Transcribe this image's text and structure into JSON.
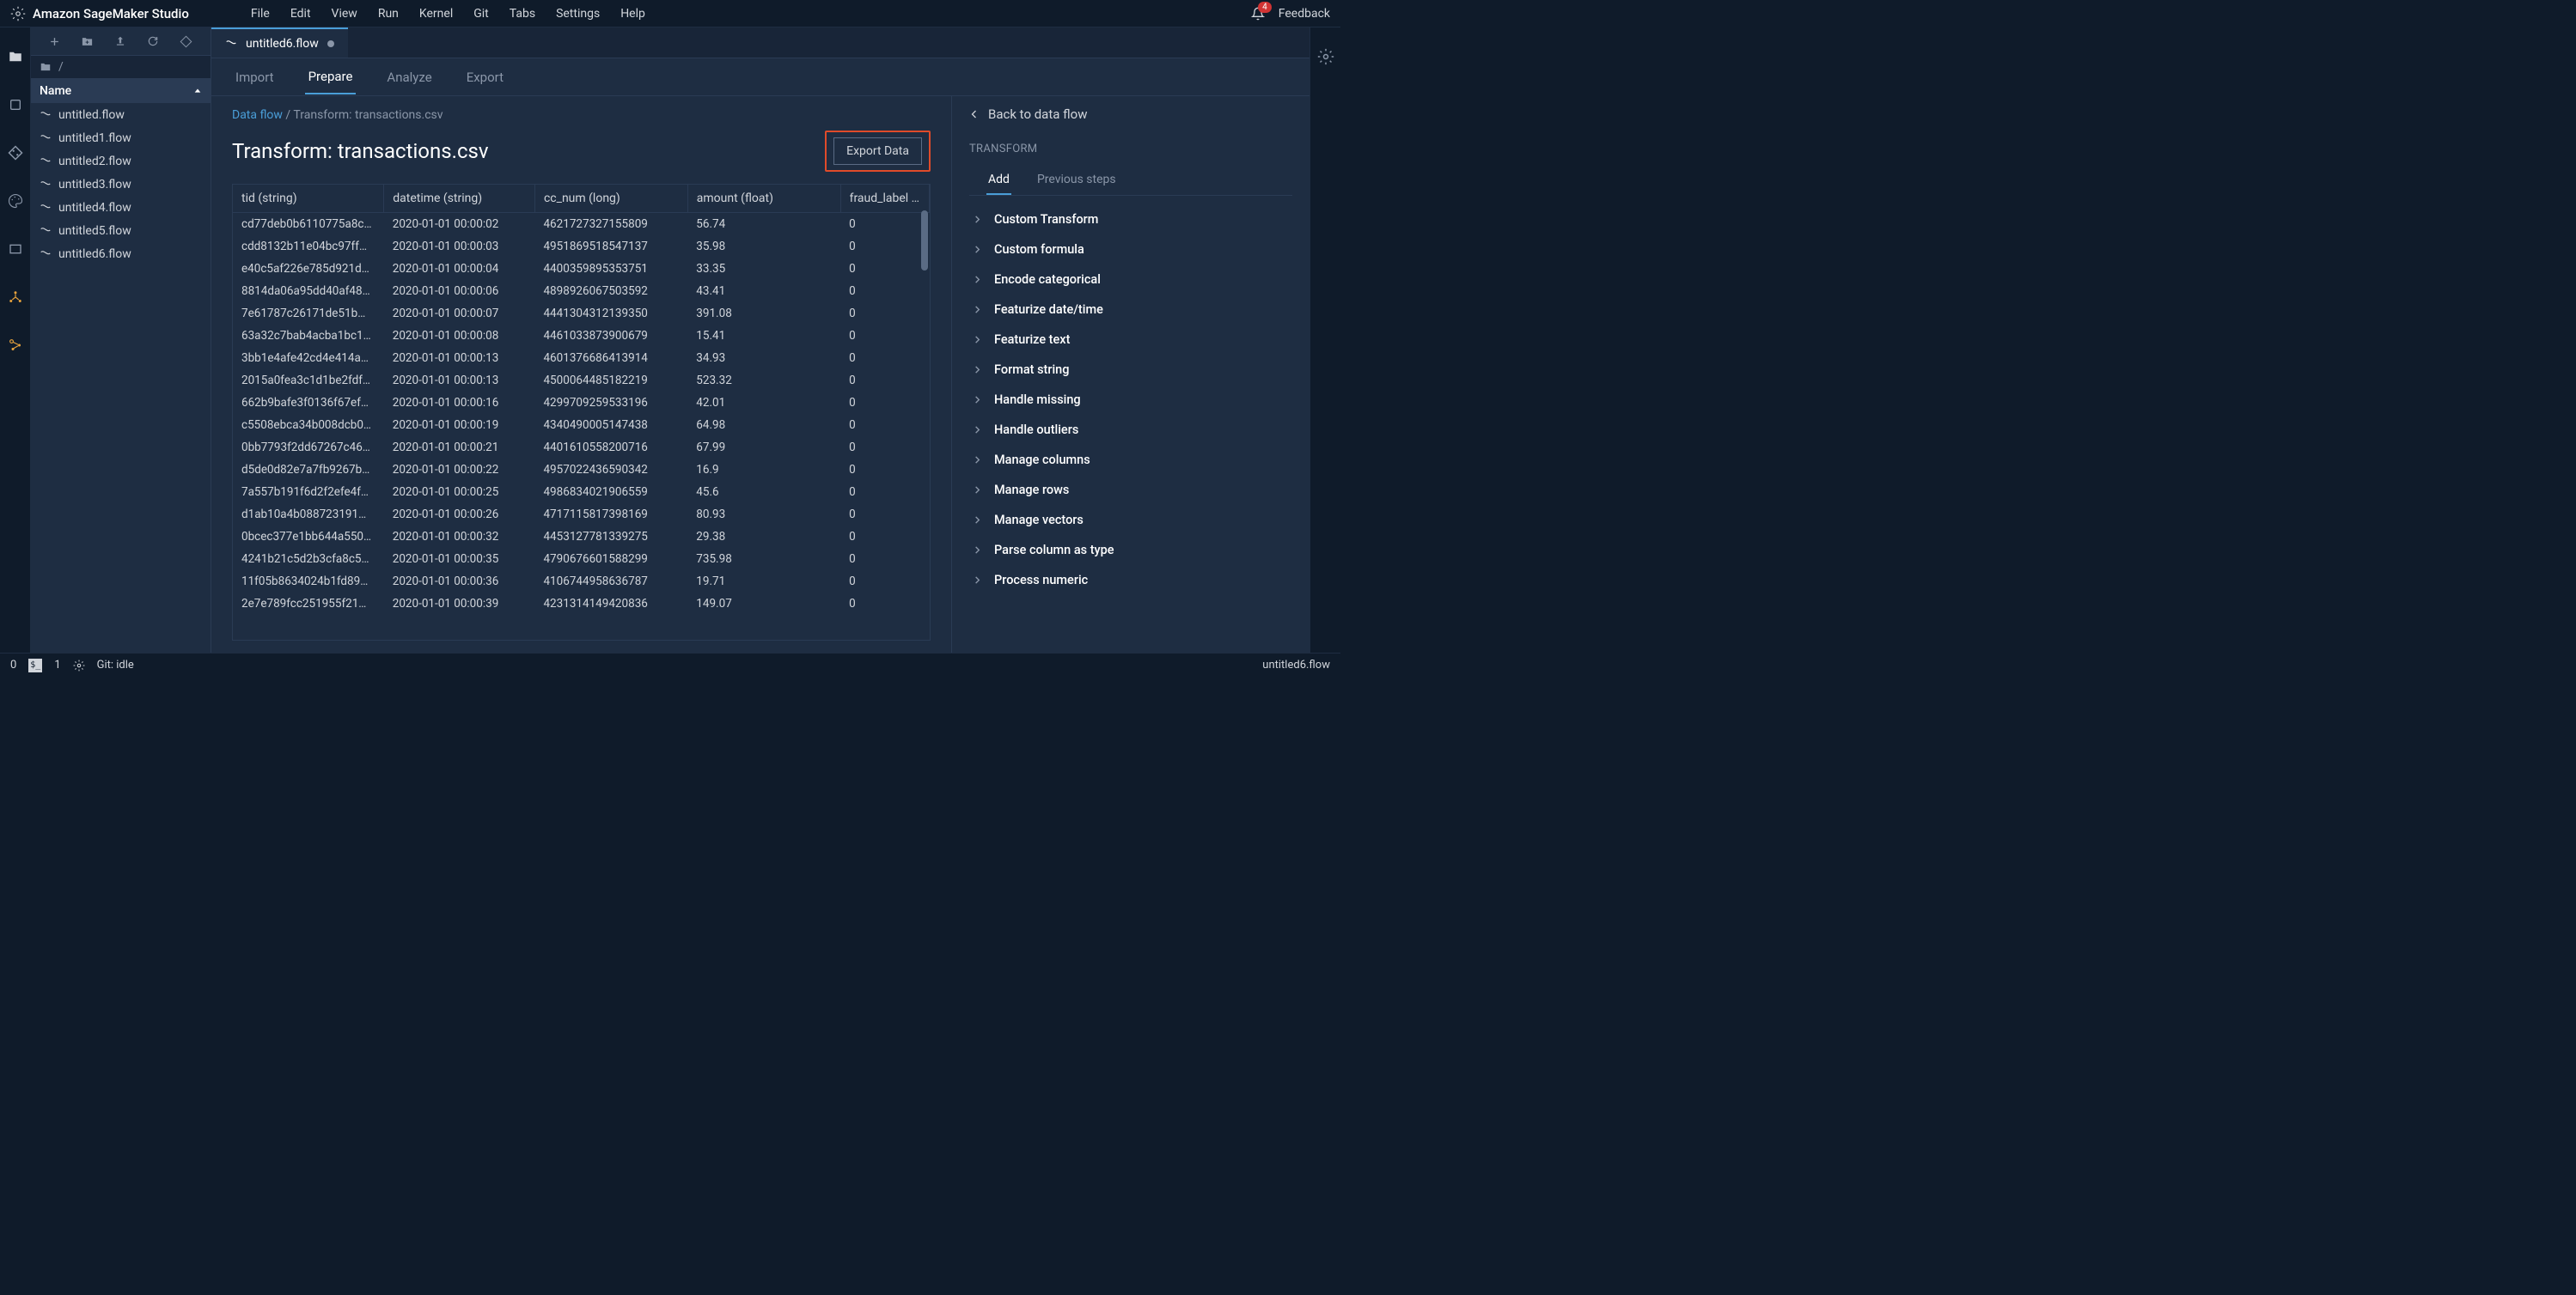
{
  "app": {
    "title": "Amazon SageMaker Studio",
    "feedback": "Feedback",
    "notif_count": "4"
  },
  "menus": [
    "File",
    "Edit",
    "View",
    "Run",
    "Kernel",
    "Git",
    "Tabs",
    "Settings",
    "Help"
  ],
  "file_browser": {
    "header": "Name",
    "crumb": "/",
    "files": [
      "untitled.flow",
      "untitled1.flow",
      "untitled2.flow",
      "untitled3.flow",
      "untitled4.flow",
      "untitled5.flow",
      "untitled6.flow"
    ]
  },
  "tab": {
    "label": "untitled6.flow"
  },
  "subtabs": [
    "Import",
    "Prepare",
    "Analyze",
    "Export"
  ],
  "active_subtab": "Prepare",
  "breadcrumb": {
    "root": "Data flow",
    "sep": "/",
    "current": "Transform: transactions.csv"
  },
  "page_title": "Transform: transactions.csv",
  "export_button": "Export Data",
  "columns": [
    "tid (string)",
    "datetime (string)",
    "cc_num (long)",
    "amount (float)",
    "fraud_label (long)"
  ],
  "rows": [
    [
      "cd77deb0b6110775a8c…",
      "2020-01-01 00:00:02",
      "4621727327155809",
      "56.74",
      "0"
    ],
    [
      "cdd8132b11e04bc97ff…",
      "2020-01-01 00:00:03",
      "4951869518547137",
      "35.98",
      "0"
    ],
    [
      "e40c5af226e785d921d…",
      "2020-01-01 00:00:04",
      "4400359895353751",
      "33.35",
      "0"
    ],
    [
      "8814da06a95dd40af48…",
      "2020-01-01 00:00:06",
      "4898926067503592",
      "43.41",
      "0"
    ],
    [
      "7e61787c26171de51b…",
      "2020-01-01 00:00:07",
      "4441304312139350",
      "391.08",
      "0"
    ],
    [
      "63a32c7bab4acba1bc1…",
      "2020-01-01 00:00:08",
      "4461033873900679",
      "15.41",
      "0"
    ],
    [
      "3bb1e4afe42cd4e414a…",
      "2020-01-01 00:00:13",
      "4601376686413914",
      "34.93",
      "0"
    ],
    [
      "2015a0fea3c1d1be2fdf…",
      "2020-01-01 00:00:13",
      "4500064485182219",
      "523.32",
      "0"
    ],
    [
      "662b9bafe3f0136f67ef…",
      "2020-01-01 00:00:16",
      "4299709259533196",
      "42.01",
      "0"
    ],
    [
      "c5508ebca34b008dcb0…",
      "2020-01-01 00:00:19",
      "4340490005147438",
      "64.98",
      "0"
    ],
    [
      "0bb7793f2dd67267c46…",
      "2020-01-01 00:00:21",
      "4401610558200716",
      "67.99",
      "0"
    ],
    [
      "d5de0d82e7a7fb9267b…",
      "2020-01-01 00:00:22",
      "4957022436590342",
      "16.9",
      "0"
    ],
    [
      "7a557b191f6d2f2efe4f…",
      "2020-01-01 00:00:25",
      "4986834021906559",
      "45.6",
      "0"
    ],
    [
      "d1ab10a4b088723191…",
      "2020-01-01 00:00:26",
      "4717115817398169",
      "80.93",
      "0"
    ],
    [
      "0bcec377e1bb644a550…",
      "2020-01-01 00:00:32",
      "4453127781339275",
      "29.38",
      "0"
    ],
    [
      "4241b21c5d2b3cfa8c5…",
      "2020-01-01 00:00:35",
      "4790676601588299",
      "735.98",
      "0"
    ],
    [
      "11f05b8634024b1fd89…",
      "2020-01-01 00:00:36",
      "4106744958636787",
      "19.71",
      "0"
    ],
    [
      "2e7e789fcc251955f21…",
      "2020-01-01 00:00:39",
      "4231314149420836",
      "149.07",
      "0"
    ]
  ],
  "right": {
    "back": "Back to data flow",
    "section": "TRANSFORM",
    "tabs": [
      "Add",
      "Previous steps"
    ],
    "active_tab": "Add",
    "items": [
      "Custom Transform",
      "Custom formula",
      "Encode categorical",
      "Featurize date/time",
      "Featurize text",
      "Format string",
      "Handle missing",
      "Handle outliers",
      "Manage columns",
      "Manage rows",
      "Manage vectors",
      "Parse column as type",
      "Process numeric"
    ]
  },
  "status": {
    "left0": "0",
    "left1": "1",
    "git": "Git: idle",
    "right": "untitled6.flow"
  }
}
